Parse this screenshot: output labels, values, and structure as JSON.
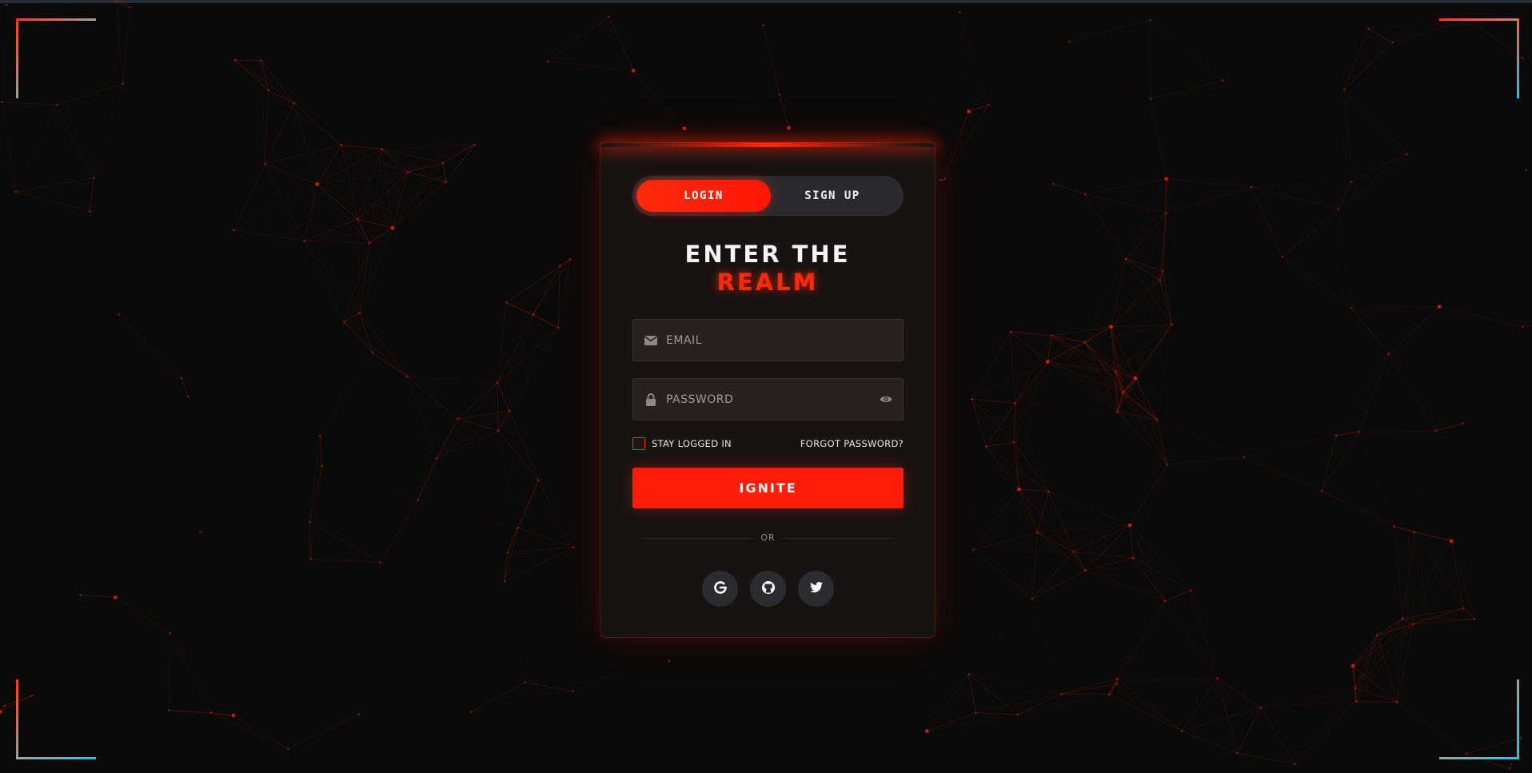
{
  "auth": {
    "tabs": {
      "login": "LOGIN",
      "signup": "SIGN UP",
      "active": "login"
    },
    "title_line1": "ENTER THE",
    "title_line2": "REALM",
    "email_placeholder": "EMAIL",
    "password_placeholder": "PASSWORD",
    "remember_label": "STAY LOGGED IN",
    "remember_checked": false,
    "forgot_label": "FORGOT PASSWORD?",
    "submit_label": "IGNITE",
    "divider_label": "OR",
    "social_providers": [
      "google",
      "github",
      "twitter"
    ]
  },
  "icons": {
    "email": "envelope-icon",
    "password": "lock-icon",
    "toggle_visibility": "eye-icon",
    "google": "google-icon",
    "github": "github-icon",
    "twitter": "twitter-icon"
  },
  "theme": {
    "accent": "#ff2a0a",
    "background": "#0a0a0a",
    "card": "#181313",
    "input": "#272121",
    "corner_gradient_warm": "#ff3a14",
    "corner_gradient_cool": "#22c4e8"
  }
}
